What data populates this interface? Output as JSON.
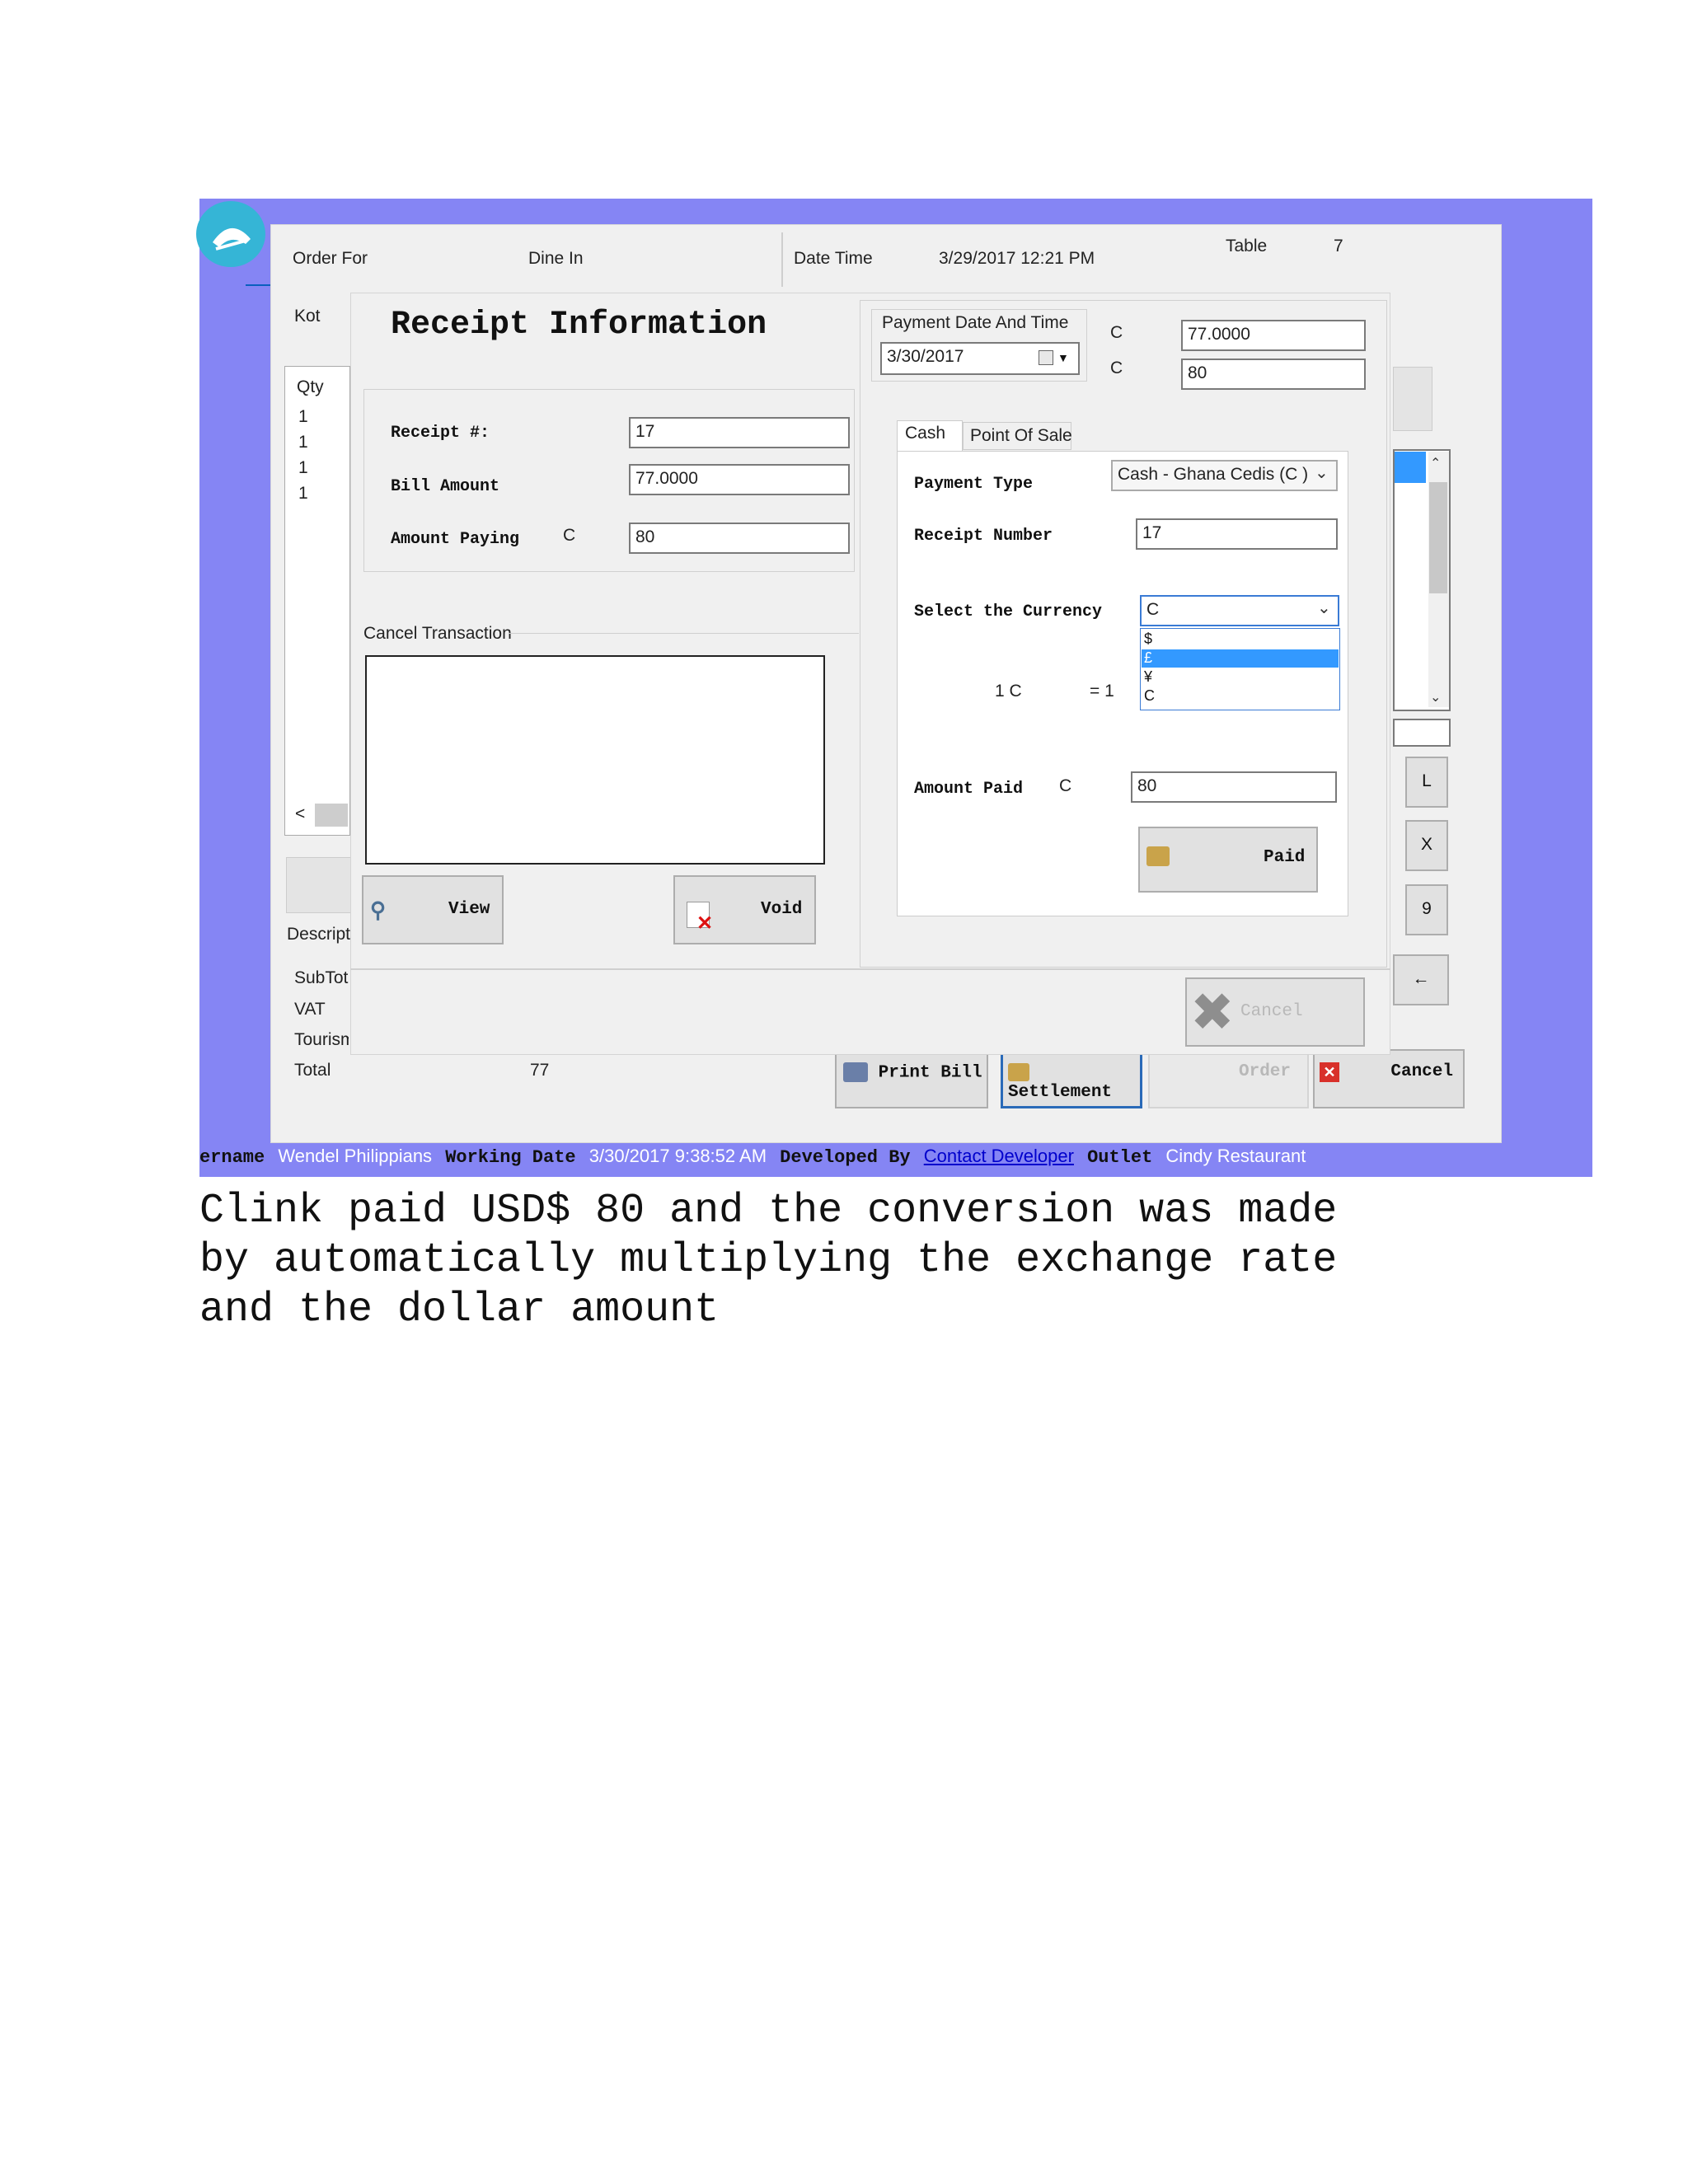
{
  "background": {
    "order_for_label": "Order For",
    "order_for_value": "Dine In",
    "date_time_label": "Date Time",
    "date_time_value": "3/29/2017 12:21 PM",
    "table_label": "Table",
    "table_value": "7",
    "kot_label": "Kot",
    "qty_header": "Qty",
    "qty_values": [
      "1",
      "1",
      "1",
      "1"
    ],
    "scroll_left": "<",
    "description_label": "Descripti",
    "subtotal_label": "SubTot",
    "vat_label": "VAT",
    "tourism_label": "Tourism",
    "total_label": "Total",
    "total_value": "77",
    "right_buttons": [
      "L",
      "X",
      "9",
      "←"
    ],
    "print_bill": "Print Bill",
    "settlement": "Settlement",
    "order": "Order",
    "cancel": "Cancel"
  },
  "receipt": {
    "title": "Receipt Information",
    "receipt_no_label": "Receipt #:",
    "receipt_no_value": "17",
    "bill_amount_label": "Bill Amount",
    "bill_amount_value": "77.0000",
    "amount_paying_label": "Amount Paying",
    "amount_paying_currency": "C",
    "amount_paying_value": "80",
    "cancel_transaction_label": "Cancel Transaction",
    "view_button": "View",
    "void_button": "Void",
    "payment_date_label": "Payment Date And Time",
    "payment_date_value": "3/30/2017",
    "top_currency_1": "C",
    "top_amount_1": "77.0000",
    "top_currency_2": "C",
    "top_amount_2": "80",
    "tabs": [
      "Cash",
      "Point Of Sale"
    ],
    "payment_type_label": "Payment Type",
    "payment_type_value": "Cash - Ghana Cedis (C )",
    "receipt_number_label": "Receipt Number",
    "receipt_number_value": "17",
    "select_currency_label": "Select the Currency",
    "select_currency_value": "C",
    "currency_options": [
      "$",
      "£",
      "¥",
      "C"
    ],
    "rate_left": "1 C",
    "rate_right": "= 1",
    "amount_paid_label": "Amount Paid",
    "amount_paid_currency": "C",
    "amount_paid_value": "80",
    "paid_button": "Paid",
    "cancel_button": "Cancel"
  },
  "status_bar": {
    "username_label": "ername",
    "username_value": "Wendel Philippians",
    "working_date_label": "Working Date",
    "working_date_value": "3/30/2017 9:38:52 AM",
    "developed_by_label": "Developed By",
    "developed_by_link": "Contact Developer",
    "outlet_label": "Outlet",
    "outlet_value": "Cindy Restaurant"
  },
  "caption": "Clink paid USD$ 80 and the conversion was made\nby automatically multiplying the exchange rate\nand the dollar amount",
  "colors": {
    "frame": "#8585f4",
    "selection": "#3399ff",
    "link": "#0000cc"
  }
}
